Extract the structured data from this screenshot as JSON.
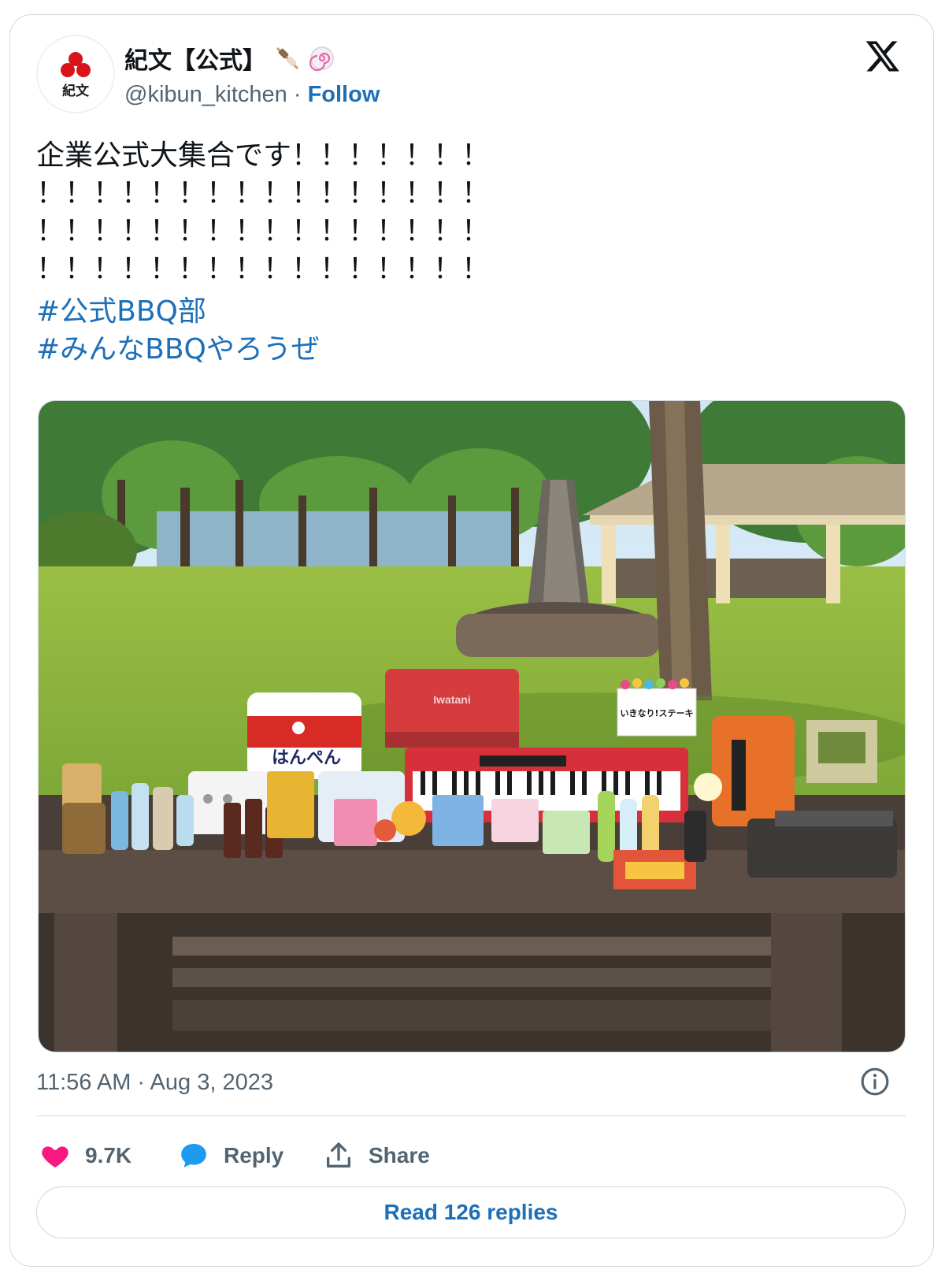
{
  "author": {
    "display_name": "紀文【公式】",
    "handle": "@kibun_kitchen",
    "separator": " · ",
    "follow_label": "Follow",
    "avatar_text": "紀文",
    "emoji_icons": [
      "oden-skewer-icon",
      "narutomaki-icon"
    ]
  },
  "tweet": {
    "text": "企業公式大集合です！！！！！！！\n！！！！！！！！！！！！！！！！\n！！！！！！！！！！！！！！！！\n！！！！！！！！！！！！！！！！",
    "hashtags": [
      "#公式BBQ部",
      "#みんなBBQやろうぜ"
    ],
    "timestamp": "11:56 AM · Aug 3, 2023"
  },
  "photo": {
    "items": {
      "iwatani_box": "Iwatani",
      "hanpen_bag": "はんぺん",
      "ikinari_box": "いきなり!ステーキ"
    }
  },
  "actions": {
    "like_count": "9.7K",
    "reply_label": "Reply",
    "share_label": "Share"
  },
  "read_replies_label": "Read 126 replies",
  "colors": {
    "link": "#1d6fb8",
    "like": "#f91880",
    "reply": "#1d9bf0",
    "muted": "#536471"
  }
}
